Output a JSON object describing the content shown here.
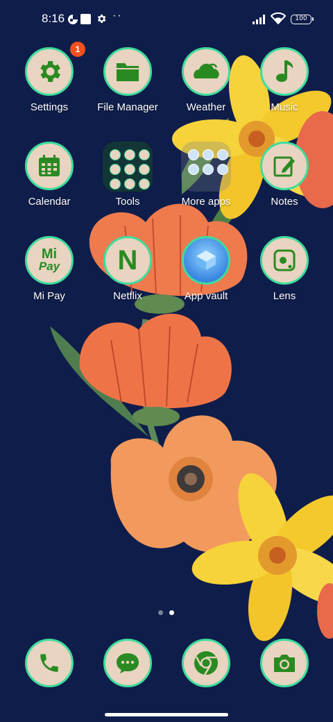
{
  "status_bar": {
    "time": "8:16",
    "battery": "100",
    "notification_icons": [
      "app-notification-icon",
      "square-notification-icon",
      "gear-icon"
    ],
    "overflow": "··"
  },
  "home": {
    "apps": [
      {
        "label": "Settings",
        "icon": "gear-icon",
        "badge": "1"
      },
      {
        "label": "File Manager",
        "icon": "folder-icon"
      },
      {
        "label": "Weather",
        "icon": "cloud-icon"
      },
      {
        "label": "Music",
        "icon": "music-note-icon"
      },
      {
        "label": "Calendar",
        "icon": "calendar-icon"
      },
      {
        "label": "Tools",
        "icon": "folder-grid"
      },
      {
        "label": "More apps",
        "icon": "folder-grid"
      },
      {
        "label": "Notes",
        "icon": "pencil-icon"
      },
      {
        "label": "Mi Pay",
        "icon": "mi-pay-icon",
        "icon_text": [
          "Mi",
          "Pay"
        ]
      },
      {
        "label": "Netflix",
        "icon": "netflix-icon",
        "icon_text": "N"
      },
      {
        "label": "App vault",
        "icon": "app-vault-icon"
      },
      {
        "label": "Lens",
        "icon": "lens-icon"
      }
    ],
    "page_indicator": {
      "pages": 2,
      "current": 2
    }
  },
  "dock": [
    {
      "name": "phone",
      "icon": "phone-icon"
    },
    {
      "name": "messages",
      "icon": "message-icon"
    },
    {
      "name": "chrome",
      "icon": "chrome-icon"
    },
    {
      "name": "camera",
      "icon": "camera-icon"
    }
  ],
  "colors": {
    "background": "#0f1d4a",
    "icon_fill": "#e8d4c0",
    "icon_ring": "#3fdc9c",
    "glyph_green": "#2a8a22",
    "badge": "#f4511e"
  }
}
